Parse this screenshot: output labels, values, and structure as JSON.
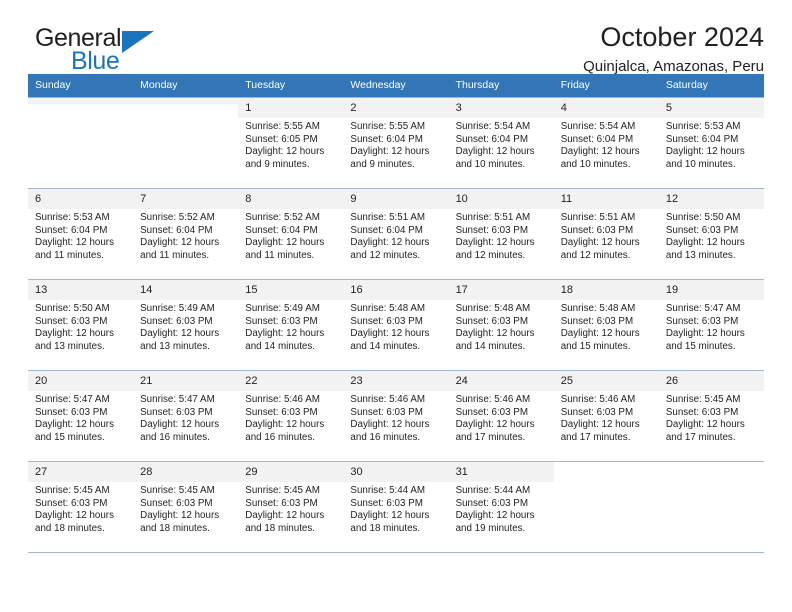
{
  "brand": {
    "word_one": "General",
    "word_two": "Blue",
    "logo_icon": "triangle-logo-icon",
    "accent_color": "#1b75bb"
  },
  "header": {
    "title": "October 2024",
    "subtitle": "Quinjalca, Amazonas, Peru",
    "header_bg_color": "#3276b8"
  },
  "weekdays": [
    "Sunday",
    "Monday",
    "Tuesday",
    "Wednesday",
    "Thursday",
    "Friday",
    "Saturday"
  ],
  "labels": {
    "sunrise_prefix": "Sunrise:",
    "sunset_prefix": "Sunset:",
    "daylight_prefix": "Daylight:"
  },
  "weeks": [
    [
      {
        "day": "",
        "blank": false,
        "sunrise": "",
        "sunset": "",
        "daylight_line1": "",
        "daylight_line2": ""
      },
      {
        "day": "",
        "blank": false,
        "sunrise": "",
        "sunset": "",
        "daylight_line1": "",
        "daylight_line2": ""
      },
      {
        "day": "1",
        "sunrise": "Sunrise: 5:55 AM",
        "sunset": "Sunset: 6:05 PM",
        "daylight_line1": "Daylight: 12 hours",
        "daylight_line2": "and 9 minutes."
      },
      {
        "day": "2",
        "sunrise": "Sunrise: 5:55 AM",
        "sunset": "Sunset: 6:04 PM",
        "daylight_line1": "Daylight: 12 hours",
        "daylight_line2": "and 9 minutes."
      },
      {
        "day": "3",
        "sunrise": "Sunrise: 5:54 AM",
        "sunset": "Sunset: 6:04 PM",
        "daylight_line1": "Daylight: 12 hours",
        "daylight_line2": "and 10 minutes."
      },
      {
        "day": "4",
        "sunrise": "Sunrise: 5:54 AM",
        "sunset": "Sunset: 6:04 PM",
        "daylight_line1": "Daylight: 12 hours",
        "daylight_line2": "and 10 minutes."
      },
      {
        "day": "5",
        "sunrise": "Sunrise: 5:53 AM",
        "sunset": "Sunset: 6:04 PM",
        "daylight_line1": "Daylight: 12 hours",
        "daylight_line2": "and 10 minutes."
      }
    ],
    [
      {
        "day": "6",
        "sunrise": "Sunrise: 5:53 AM",
        "sunset": "Sunset: 6:04 PM",
        "daylight_line1": "Daylight: 12 hours",
        "daylight_line2": "and 11 minutes."
      },
      {
        "day": "7",
        "sunrise": "Sunrise: 5:52 AM",
        "sunset": "Sunset: 6:04 PM",
        "daylight_line1": "Daylight: 12 hours",
        "daylight_line2": "and 11 minutes."
      },
      {
        "day": "8",
        "sunrise": "Sunrise: 5:52 AM",
        "sunset": "Sunset: 6:04 PM",
        "daylight_line1": "Daylight: 12 hours",
        "daylight_line2": "and 11 minutes."
      },
      {
        "day": "9",
        "sunrise": "Sunrise: 5:51 AM",
        "sunset": "Sunset: 6:04 PM",
        "daylight_line1": "Daylight: 12 hours",
        "daylight_line2": "and 12 minutes."
      },
      {
        "day": "10",
        "sunrise": "Sunrise: 5:51 AM",
        "sunset": "Sunset: 6:03 PM",
        "daylight_line1": "Daylight: 12 hours",
        "daylight_line2": "and 12 minutes."
      },
      {
        "day": "11",
        "sunrise": "Sunrise: 5:51 AM",
        "sunset": "Sunset: 6:03 PM",
        "daylight_line1": "Daylight: 12 hours",
        "daylight_line2": "and 12 minutes."
      },
      {
        "day": "12",
        "sunrise": "Sunrise: 5:50 AM",
        "sunset": "Sunset: 6:03 PM",
        "daylight_line1": "Daylight: 12 hours",
        "daylight_line2": "and 13 minutes."
      }
    ],
    [
      {
        "day": "13",
        "sunrise": "Sunrise: 5:50 AM",
        "sunset": "Sunset: 6:03 PM",
        "daylight_line1": "Daylight: 12 hours",
        "daylight_line2": "and 13 minutes."
      },
      {
        "day": "14",
        "sunrise": "Sunrise: 5:49 AM",
        "sunset": "Sunset: 6:03 PM",
        "daylight_line1": "Daylight: 12 hours",
        "daylight_line2": "and 13 minutes."
      },
      {
        "day": "15",
        "sunrise": "Sunrise: 5:49 AM",
        "sunset": "Sunset: 6:03 PM",
        "daylight_line1": "Daylight: 12 hours",
        "daylight_line2": "and 14 minutes."
      },
      {
        "day": "16",
        "sunrise": "Sunrise: 5:48 AM",
        "sunset": "Sunset: 6:03 PM",
        "daylight_line1": "Daylight: 12 hours",
        "daylight_line2": "and 14 minutes."
      },
      {
        "day": "17",
        "sunrise": "Sunrise: 5:48 AM",
        "sunset": "Sunset: 6:03 PM",
        "daylight_line1": "Daylight: 12 hours",
        "daylight_line2": "and 14 minutes."
      },
      {
        "day": "18",
        "sunrise": "Sunrise: 5:48 AM",
        "sunset": "Sunset: 6:03 PM",
        "daylight_line1": "Daylight: 12 hours",
        "daylight_line2": "and 15 minutes."
      },
      {
        "day": "19",
        "sunrise": "Sunrise: 5:47 AM",
        "sunset": "Sunset: 6:03 PM",
        "daylight_line1": "Daylight: 12 hours",
        "daylight_line2": "and 15 minutes."
      }
    ],
    [
      {
        "day": "20",
        "sunrise": "Sunrise: 5:47 AM",
        "sunset": "Sunset: 6:03 PM",
        "daylight_line1": "Daylight: 12 hours",
        "daylight_line2": "and 15 minutes."
      },
      {
        "day": "21",
        "sunrise": "Sunrise: 5:47 AM",
        "sunset": "Sunset: 6:03 PM",
        "daylight_line1": "Daylight: 12 hours",
        "daylight_line2": "and 16 minutes."
      },
      {
        "day": "22",
        "sunrise": "Sunrise: 5:46 AM",
        "sunset": "Sunset: 6:03 PM",
        "daylight_line1": "Daylight: 12 hours",
        "daylight_line2": "and 16 minutes."
      },
      {
        "day": "23",
        "sunrise": "Sunrise: 5:46 AM",
        "sunset": "Sunset: 6:03 PM",
        "daylight_line1": "Daylight: 12 hours",
        "daylight_line2": "and 16 minutes."
      },
      {
        "day": "24",
        "sunrise": "Sunrise: 5:46 AM",
        "sunset": "Sunset: 6:03 PM",
        "daylight_line1": "Daylight: 12 hours",
        "daylight_line2": "and 17 minutes."
      },
      {
        "day": "25",
        "sunrise": "Sunrise: 5:46 AM",
        "sunset": "Sunset: 6:03 PM",
        "daylight_line1": "Daylight: 12 hours",
        "daylight_line2": "and 17 minutes."
      },
      {
        "day": "26",
        "sunrise": "Sunrise: 5:45 AM",
        "sunset": "Sunset: 6:03 PM",
        "daylight_line1": "Daylight: 12 hours",
        "daylight_line2": "and 17 minutes."
      }
    ],
    [
      {
        "day": "27",
        "sunrise": "Sunrise: 5:45 AM",
        "sunset": "Sunset: 6:03 PM",
        "daylight_line1": "Daylight: 12 hours",
        "daylight_line2": "and 18 minutes."
      },
      {
        "day": "28",
        "sunrise": "Sunrise: 5:45 AM",
        "sunset": "Sunset: 6:03 PM",
        "daylight_line1": "Daylight: 12 hours",
        "daylight_line2": "and 18 minutes."
      },
      {
        "day": "29",
        "sunrise": "Sunrise: 5:45 AM",
        "sunset": "Sunset: 6:03 PM",
        "daylight_line1": "Daylight: 12 hours",
        "daylight_line2": "and 18 minutes."
      },
      {
        "day": "30",
        "sunrise": "Sunrise: 5:44 AM",
        "sunset": "Sunset: 6:03 PM",
        "daylight_line1": "Daylight: 12 hours",
        "daylight_line2": "and 18 minutes."
      },
      {
        "day": "31",
        "sunrise": "Sunrise: 5:44 AM",
        "sunset": "Sunset: 6:03 PM",
        "daylight_line1": "Daylight: 12 hours",
        "daylight_line2": "and 19 minutes."
      },
      {
        "day": "",
        "blank": true,
        "sunrise": "",
        "sunset": "",
        "daylight_line1": "",
        "daylight_line2": ""
      },
      {
        "day": "",
        "blank": true,
        "sunrise": "",
        "sunset": "",
        "daylight_line1": "",
        "daylight_line2": ""
      }
    ]
  ]
}
